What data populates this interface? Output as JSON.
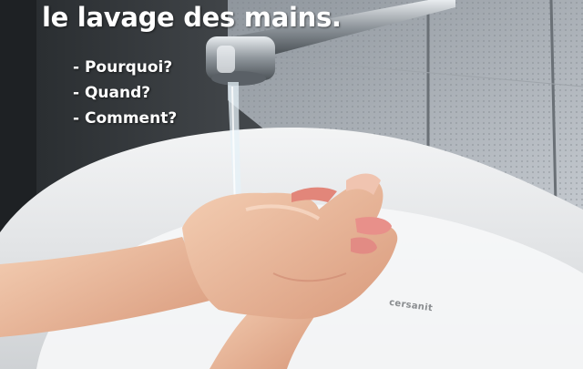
{
  "title": "le lavage des mains.",
  "questions": [
    "- Pourquoi?",
    "- Quand?",
    "- Comment?"
  ],
  "sink_brand": "cersanit",
  "colors": {
    "wall": "#3a3e42",
    "tile_wall": "#b7bdc4",
    "sink": "#e9ebec",
    "skin": "#f1c3a4",
    "text": "#ffffff"
  },
  "icons": [
    "faucet",
    "water-stream",
    "hands",
    "sink",
    "tiles"
  ]
}
